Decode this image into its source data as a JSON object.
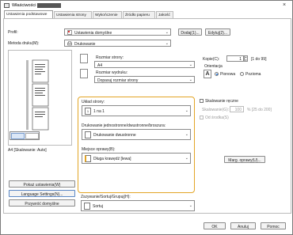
{
  "window": {
    "title": "Właściwości",
    "close": "×"
  },
  "tabs": [
    {
      "label": "Ustawienia podstawowe"
    },
    {
      "label": "Ustawienia strony"
    },
    {
      "label": "Wykończenie"
    },
    {
      "label": "Źródło papieru"
    },
    {
      "label": "Jakość"
    }
  ],
  "profile": {
    "label": "Profil:",
    "value": "Ustawienia domyślne",
    "add_button": "Dodaj(1)...",
    "edit_button": "Edytuj(2)..."
  },
  "output_method": {
    "label": "Metoda druku(M):",
    "value": "Drukowanie"
  },
  "page_size": {
    "label": "Rozmiar strony:",
    "value": "A4"
  },
  "output_size": {
    "label": "Rozmiar wydruku:",
    "value": "Dopasuj rozmiar strony"
  },
  "copies": {
    "label": "Kopie(C):",
    "value": "1",
    "range": "[1 do 99]"
  },
  "orientation": {
    "label": "Orientacja",
    "portrait": "Pionowa",
    "landscape": "Pozioma",
    "selected": "portrait"
  },
  "layout": {
    "label": "Układ strony:",
    "value": "1 na 1"
  },
  "duplex": {
    "label": "Drukowanie jednostronne/dwustronne/broszura:",
    "value": "Drukowanie dwustronne"
  },
  "binding": {
    "label": "Miejsce oprawy(B):",
    "value": "Długa krawędź [lewa]"
  },
  "manual_scaling": {
    "label": "Skalowanie ręczne",
    "scaling_label": "Skalowanie(G):",
    "scaling_value": "100",
    "scaling_range": "% [25 do 200]",
    "center_label": "Od środka(S)"
  },
  "gutter_button": "Marg. oprawy(U)...",
  "finishing": {
    "label": "Zszywanie/Sortuj/Grupuj(H):",
    "value": "Sortuj"
  },
  "preview": {
    "caption": "A4 [Skalowanie: Auto]"
  },
  "left_buttons": {
    "show_settings": "Pokaż ustawienia(W)",
    "language_settings": "Language Settings(N)...",
    "restore_defaults": "Przywróć domyślne"
  },
  "dialog_buttons": {
    "ok": "OK",
    "cancel": "Anuluj",
    "help": "Pomoc"
  },
  "colors": {
    "highlight": "#e3a526",
    "accent": "#1a6fd6"
  }
}
